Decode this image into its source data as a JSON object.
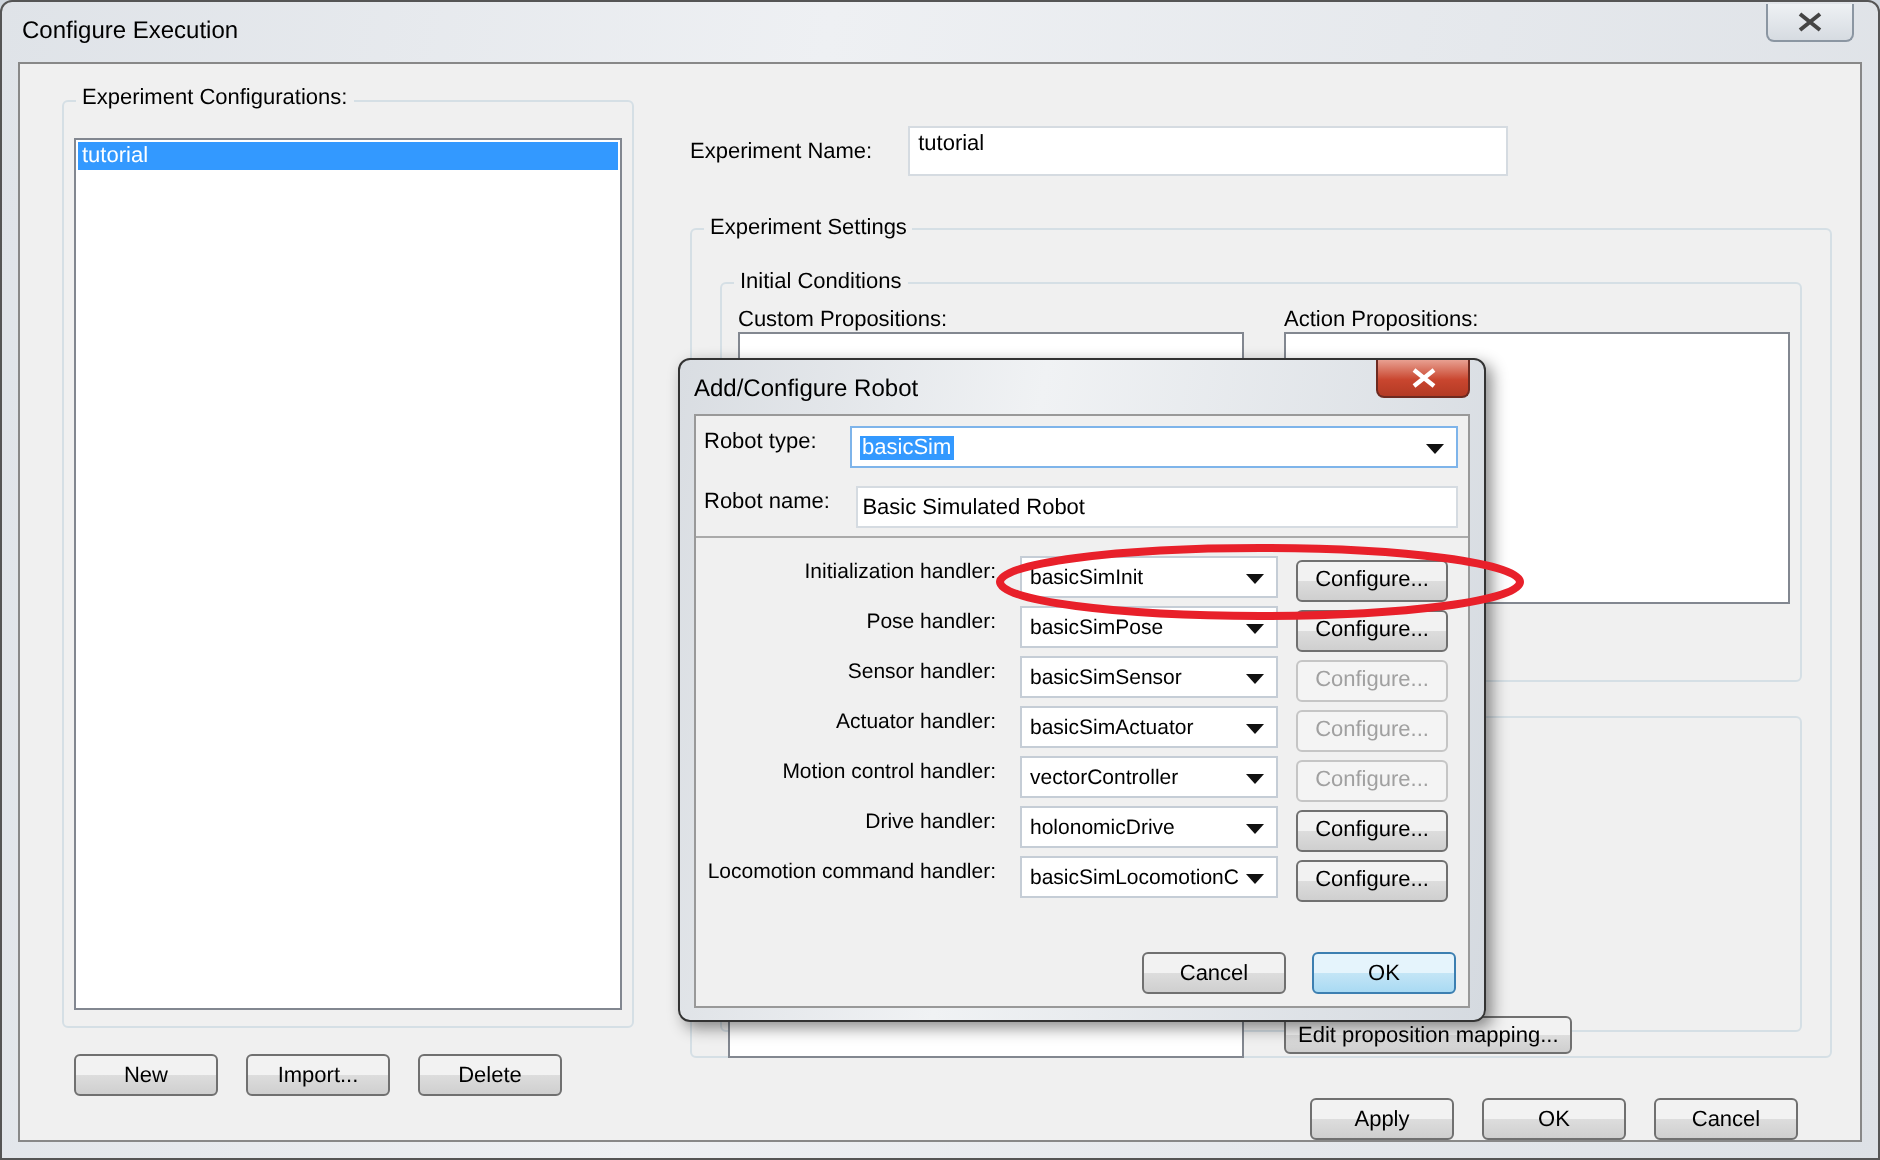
{
  "window": {
    "title": "Configure Execution"
  },
  "configurations": {
    "label": "Experiment Configurations:",
    "items": [
      {
        "label": "tutorial",
        "selected": true
      }
    ],
    "buttons": [
      "New",
      "Import...",
      "Delete"
    ]
  },
  "experiment_name": {
    "label": "Experiment Name:",
    "value": "tutorial"
  },
  "settings": {
    "title": "Experiment Settings",
    "initial_conditions": {
      "title": "Initial Conditions",
      "custom_label": "Custom Propositions:",
      "action_label": "Action Propositions:"
    },
    "mapping_button": "Edit proposition mapping..."
  },
  "buttons": [
    "Apply",
    "OK",
    "Cancel"
  ],
  "dialog": {
    "title": "Add/Configure Robot",
    "robot_type": {
      "label": "Robot type:",
      "value": "basicSim"
    },
    "robot_name": {
      "label": "Robot name:",
      "value": "Basic Simulated Robot"
    },
    "handlers": [
      {
        "label": "Initialization handler:",
        "value": "basicSimInit",
        "configure": "Configure...",
        "disabled": false
      },
      {
        "label": "Pose handler:",
        "value": "basicSimPose",
        "configure": "Configure...",
        "disabled": false
      },
      {
        "label": "Sensor handler:",
        "value": "basicSimSensor",
        "configure": "Configure...",
        "disabled": true
      },
      {
        "label": "Actuator handler:",
        "value": "basicSimActuator",
        "configure": "Configure...",
        "disabled": true
      },
      {
        "label": "Motion control handler:",
        "value": "vectorController",
        "configure": "Configure...",
        "disabled": true
      },
      {
        "label": "Drive handler:",
        "value": "holonomicDrive",
        "configure": "Configure...",
        "disabled": false
      },
      {
        "label": "Locomotion command handler:",
        "value": "basicSimLocomotionC",
        "configure": "Configure...",
        "disabled": false
      }
    ],
    "buttons": [
      {
        "label": "Cancel",
        "default": false
      },
      {
        "label": "OK",
        "default": true
      }
    ]
  }
}
